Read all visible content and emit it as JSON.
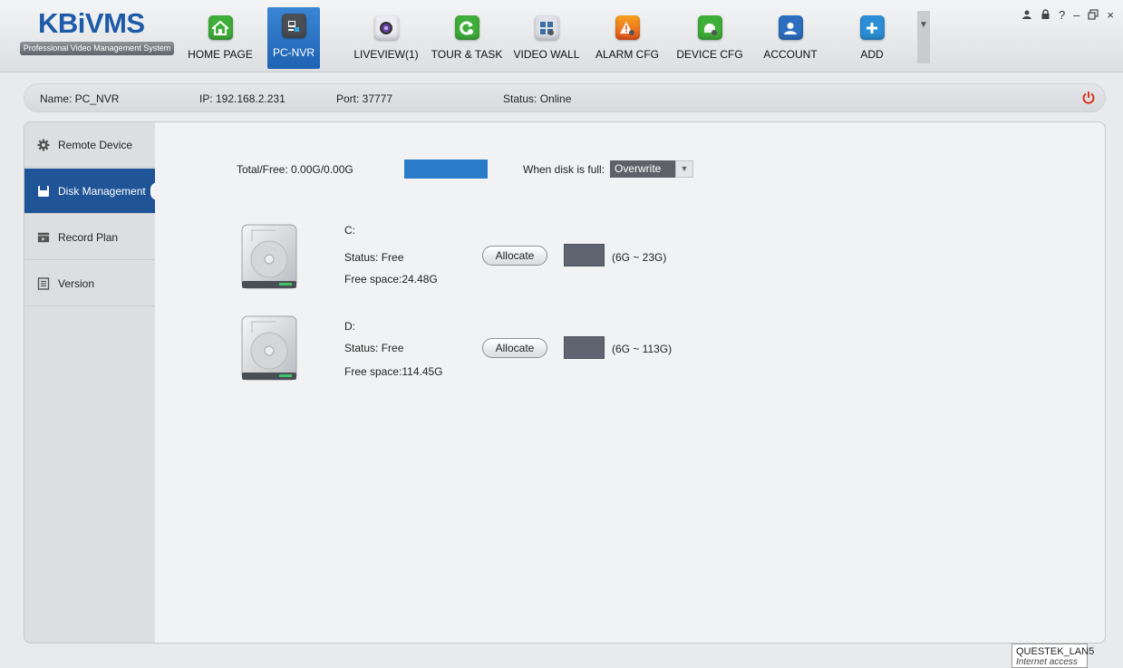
{
  "app": {
    "logo_text": "KBiVMS",
    "logo_subtitle": "Professional Video Management System"
  },
  "nav": [
    {
      "label": "HOME PAGE",
      "icon": "home-icon",
      "color": "#3fae3a",
      "active": false
    },
    {
      "label": "PC-NVR",
      "icon": "pc-nvr-icon",
      "color": "#4a4e55",
      "active": true
    },
    {
      "label": "LIVEVIEW(1)",
      "icon": "camera-icon",
      "color": "#e8e8ee",
      "active": false
    },
    {
      "label": "TOUR & TASK",
      "icon": "refresh-icon",
      "color": "#3fae3a",
      "active": false
    },
    {
      "label": "VIDEO WALL",
      "icon": "video-wall-icon",
      "color": "#5c6e86",
      "active": false
    },
    {
      "label": "ALARM CFG",
      "icon": "alarm-icon",
      "color": "#f07a1c",
      "active": false
    },
    {
      "label": "DEVICE CFG",
      "icon": "device-cfg-icon",
      "color": "#3fae3a",
      "active": false
    },
    {
      "label": "ACCOUNT",
      "icon": "account-icon",
      "color": "#2c6fc0",
      "active": false
    },
    {
      "label": "ADD",
      "icon": "add-icon",
      "color": "#2c8fd6",
      "active": false
    }
  ],
  "window_controls": {
    "user": "♣",
    "lock": "▲",
    "help": "?",
    "minimize": "–",
    "restore": "❐",
    "close": "×"
  },
  "device": {
    "name": "Name:  PC_NVR",
    "ip": "IP:  192.168.2.231",
    "port": "Port:   37777",
    "status": "Status: Online"
  },
  "sidebar": [
    {
      "label": "Remote Device",
      "icon": "gear-icon",
      "active": false
    },
    {
      "label": "Disk Management",
      "icon": "disk-icon",
      "active": true
    },
    {
      "label": "Record Plan",
      "icon": "record-plan-icon",
      "active": false
    },
    {
      "label": "Version",
      "icon": "version-icon",
      "active": false
    }
  ],
  "disk_management": {
    "total_free": "Total/Free: 0.00G/0.00G",
    "when_full_label": "When disk is full:",
    "when_full_value": "Overwrite",
    "disks": [
      {
        "drive": "C:",
        "status": "Status: Free",
        "free_space": "Free space:24.48G",
        "allocate_label": "Allocate",
        "allocate_value": "",
        "range": "(6G ~ 23G)"
      },
      {
        "drive": "D:",
        "status": "Status: Free",
        "free_space": "Free space:114.45G",
        "allocate_label": "Allocate",
        "allocate_value": "",
        "range": "(6G ~ 113G)"
      }
    ]
  },
  "network_tooltip": {
    "name": "QUESTEK_LAN5",
    "status": "Internet access"
  },
  "colors": {
    "accent_blue": "#1f5596",
    "nav_active": "#2a74c4",
    "power_red": "#d9341c"
  }
}
